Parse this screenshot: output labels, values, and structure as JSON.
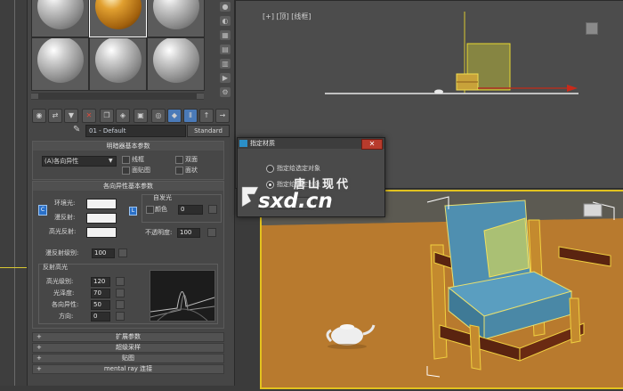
{
  "material_editor": {
    "material_name": "01 - Default",
    "material_type": "Standard",
    "shader_rollout": {
      "title": "明暗器基本参数",
      "shader": "(A)各向异性",
      "options": [
        "线框",
        "双面",
        "面贴图",
        "面状"
      ]
    },
    "params_rollout": {
      "title": "各向异性基本参数",
      "ambient_label": "环境光:",
      "diffuse_label": "漫反射:",
      "specular_label": "高光反射:",
      "self_illum_title": "自发光",
      "color_label": "颜色",
      "self_illum_value": "0",
      "opacity_label": "不透明度:",
      "opacity_value": "100",
      "diffuse_level_label": "漫反射级别:",
      "diffuse_level_value": "100",
      "highlight_title": "反射高光",
      "specular_level_label": "高光级别:",
      "specular_level_value": "120",
      "glossiness_label": "光泽度:",
      "glossiness_value": "70",
      "anisotropy_label": "各向异性:",
      "anisotropy_value": "50",
      "orientation_label": "方向:",
      "orientation_value": "0"
    },
    "collapsed_rollouts": [
      "扩展参数",
      "超级采样",
      "贴图",
      "mental ray 连接"
    ]
  },
  "viewport_top": {
    "label": "[+] [顶] [线框]"
  },
  "dialog": {
    "title": "指定材质",
    "option1": "指定给选定对象",
    "option2": "指定给选定对象"
  },
  "watermark": {
    "cn": "唐山现代",
    "en": "sxd.cn"
  },
  "colors": {
    "accent_yellow": "#e2c21e",
    "floor_wood": "#b87a2e",
    "chair_blue": "#4f8fb0",
    "close_red": "#b73b2c"
  }
}
